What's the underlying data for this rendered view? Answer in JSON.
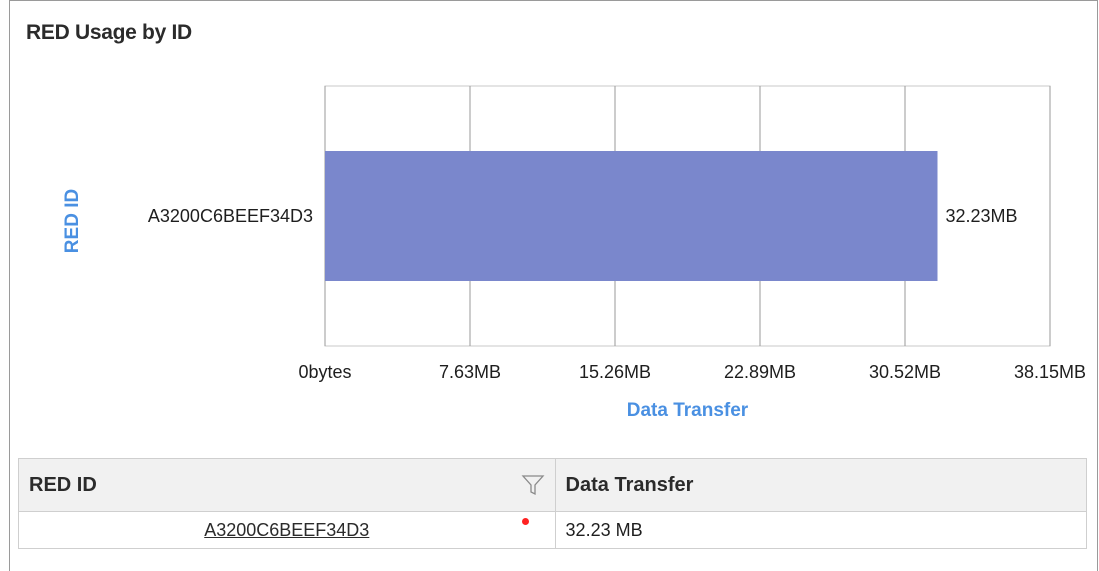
{
  "title": "RED Usage by ID",
  "chart_data": {
    "type": "bar",
    "orientation": "horizontal",
    "categories": [
      "A3200C6BEEF34D3"
    ],
    "values": [
      32.23
    ],
    "value_labels": [
      "32.23MB"
    ],
    "xlabel": "Data Transfer",
    "ylabel": "RED ID",
    "xlim": [
      0,
      38.15
    ],
    "x_ticks": [
      0,
      7.63,
      15.26,
      22.89,
      30.52,
      38.15
    ],
    "x_tick_labels": [
      "0bytes",
      "7.63MB",
      "15.26MB",
      "22.89MB",
      "30.52MB",
      "38.15MB"
    ],
    "grid": true,
    "colors": {
      "bar": "#7a87cc",
      "axis_title": "#4a90e2",
      "grid": "#c8c8c8"
    }
  },
  "table": {
    "headers": {
      "red_id": "RED ID",
      "data_transfer": "Data Transfer"
    },
    "filter_icon": "filter-icon",
    "rows": [
      {
        "red_id": "A3200C6BEEF34D3",
        "data_transfer": "32.23 MB",
        "status_color": "#ff2222"
      }
    ]
  }
}
